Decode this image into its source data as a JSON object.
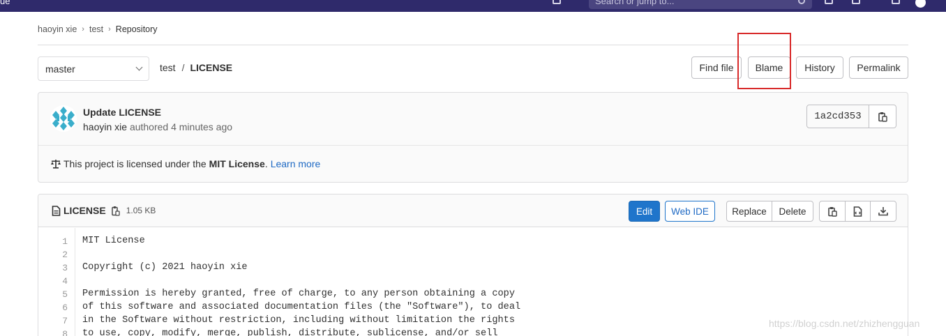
{
  "topnav": {
    "brand_fragment": "ue",
    "search_placeholder": "Search or jump to..."
  },
  "breadcrumb": [
    "haoyin xie",
    "test",
    "Repository"
  ],
  "branch": {
    "selected": "master"
  },
  "path": {
    "project": "test",
    "separator": "/",
    "file": "LICENSE"
  },
  "actions": {
    "find_file": "Find file",
    "blame": "Blame",
    "history": "History",
    "permalink": "Permalink"
  },
  "commit": {
    "title": "Update LICENSE",
    "author": "haoyin xie",
    "authored_text": "authored 4 minutes ago",
    "sha": "1a2cd353"
  },
  "license_notice": {
    "prefix": "This project is licensed under the",
    "license": "MIT License",
    "suffix": ".",
    "link": "Learn more"
  },
  "file": {
    "name": "LICENSE",
    "size": "1.05 KB",
    "buttons": {
      "edit": "Edit",
      "web_ide": "Web IDE",
      "replace": "Replace",
      "delete": "Delete"
    },
    "lines": [
      {
        "n": "1",
        "text": "MIT License"
      },
      {
        "n": "2",
        "text": ""
      },
      {
        "n": "3",
        "text": "Copyright (c) 2021 haoyin xie"
      },
      {
        "n": "4",
        "text": ""
      },
      {
        "n": "5",
        "text": "Permission is hereby granted, free of charge, to any person obtaining a copy"
      },
      {
        "n": "6",
        "text": "of this software and associated documentation files (the \"Software\"), to deal"
      },
      {
        "n": "7",
        "text": "in the Software without restriction, including without limitation the rights"
      },
      {
        "n": "8",
        "text": "to use, copy, modify, merge, publish, distribute, sublicense, and/or sell"
      }
    ]
  },
  "watermark": "https://blog.csdn.net/zhizhengguan",
  "colors": {
    "nav_bg": "#2f2a6b",
    "primary": "#1f75cb",
    "highlight": "#d82a2a"
  }
}
